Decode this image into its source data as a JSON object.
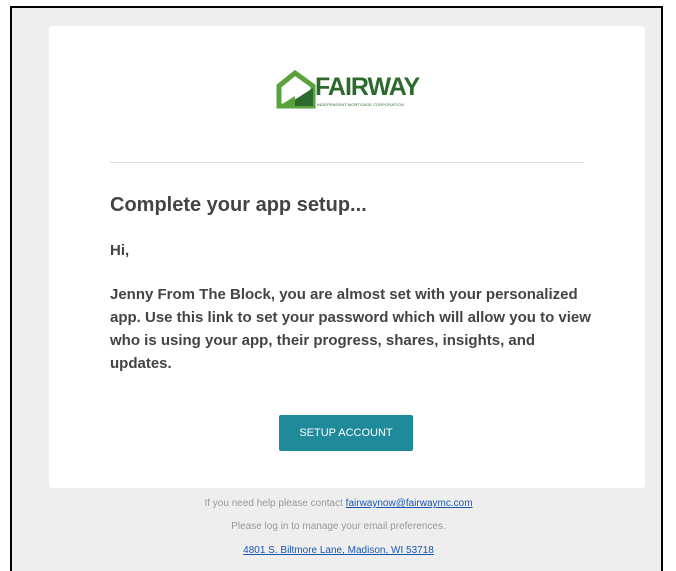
{
  "brand": {
    "name": "FAIRWAY",
    "tagline": "INDEPENDENT MORTGAGE CORPORATION",
    "color": "#2d6a2e"
  },
  "email": {
    "heading": "Complete your app setup...",
    "greeting": "Hi,",
    "body": "Jenny From The Block, you are almost set with your personalized app. Use this link to set your password which will allow you to view who is using your app, their progress, shares, insights, and updates.",
    "cta_label": "SETUP ACCOUNT",
    "cta_color": "#1f8a99"
  },
  "footer": {
    "help_text": "If you need help please contact ",
    "help_email": "fairwaynow@fairwaymc.com",
    "preferences_text": "Please log in to manage your email preferences.",
    "address": "4801 S. Biltmore Lane, Madison, WI 53718"
  }
}
